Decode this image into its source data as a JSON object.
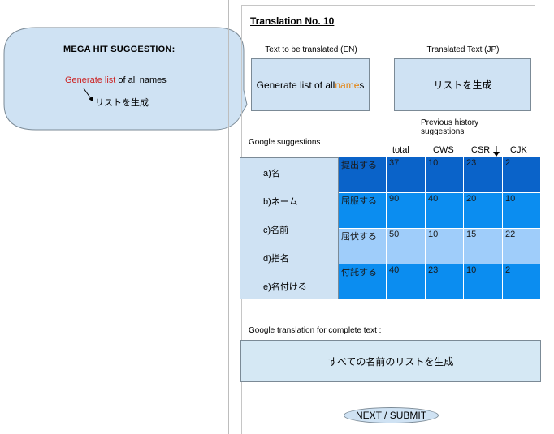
{
  "panel": {
    "title": "Translation No. 10",
    "source_label": "Text to be translated  (EN)",
    "target_label": "Translated Text (JP)",
    "source_text_pre": "Generate list of all ",
    "source_text_hl": "name",
    "source_text_post": "s",
    "target_text": "リストを生成"
  },
  "bubble": {
    "heading": "MEGA HIT SUGGESTION:",
    "link_text": "Generate list",
    "link_rest": " of all names",
    "translation": "リストを生成"
  },
  "suggestions": {
    "label": "Google suggestions",
    "items": [
      "a)名",
      "b)ネーム",
      "c)名前",
      "d)指名",
      "e)名付ける"
    ]
  },
  "history": {
    "label_line1": "Previous history",
    "label_line2": "suggestions",
    "headers": [
      "total",
      "CWS",
      "CSR",
      "CJK"
    ],
    "rows": [
      {
        "term": "提出する",
        "values": [
          "37",
          "10",
          "23",
          "2"
        ],
        "color": "#0a63c9"
      },
      {
        "term": "屈服する",
        "values": [
          "90",
          "40",
          "20",
          "10"
        ],
        "color": "#0b8df0"
      },
      {
        "term": "屈伏する",
        "values": [
          "50",
          "10",
          "15",
          "22"
        ],
        "color": "#9fcdfa"
      },
      {
        "term": "付託する",
        "values": [
          "40",
          "23",
          "10",
          "2"
        ],
        "color": "#0b8df0"
      }
    ]
  },
  "google_translation": {
    "label": "Google translation for complete text :",
    "text": "すべての名前のリストを生成"
  },
  "next_button": "NEXT / SUBMIT",
  "colors": {
    "box_fill": "#cfe2f3",
    "link": "#cc2222",
    "highlight": "#e67e00"
  }
}
